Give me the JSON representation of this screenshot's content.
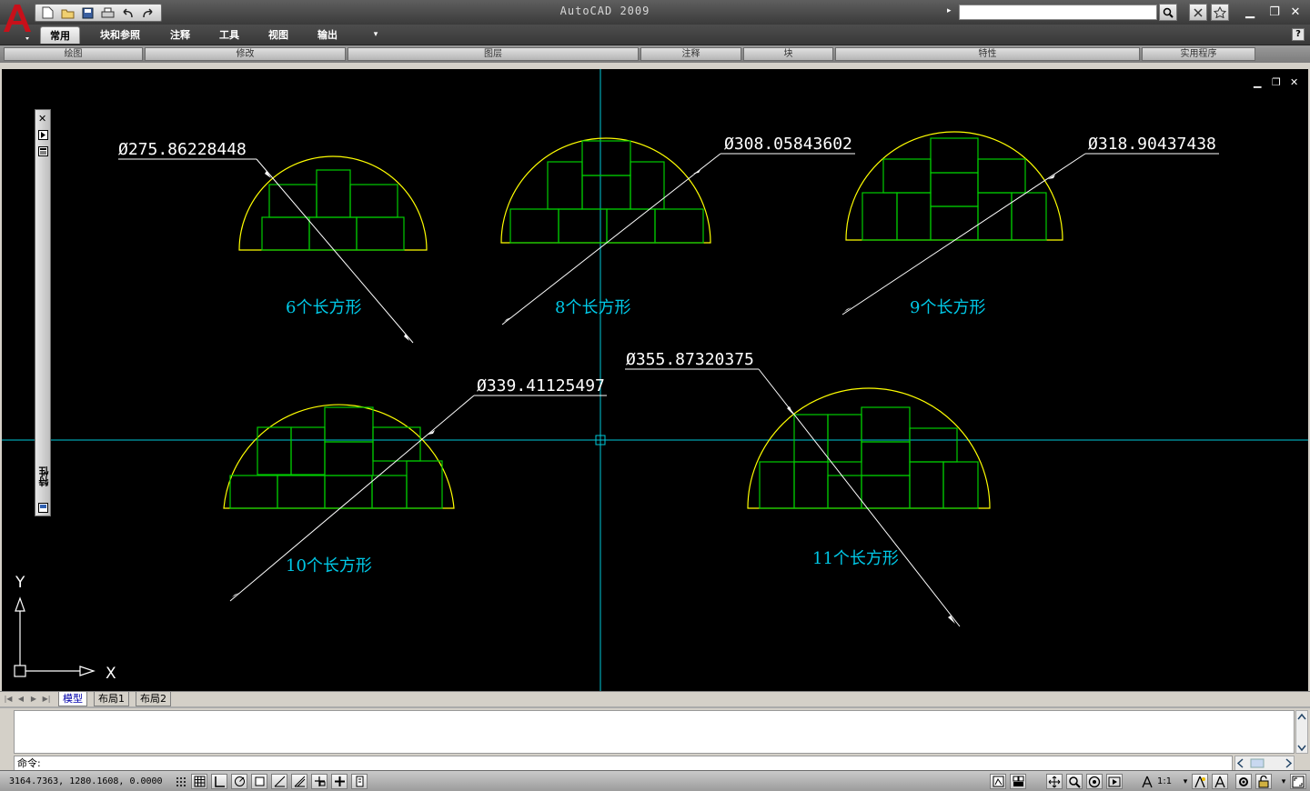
{
  "window": {
    "title": "AutoCAD 2009"
  },
  "search": {
    "placeholder": ""
  },
  "ribbon": {
    "tabs": [
      {
        "label": "常用",
        "active": true
      },
      {
        "label": "块和参照"
      },
      {
        "label": "注释"
      },
      {
        "label": "工具"
      },
      {
        "label": "视图"
      },
      {
        "label": "输出"
      }
    ],
    "panels": [
      "绘图",
      "修改",
      "图层",
      "注释",
      "块",
      "特性",
      "实用程序"
    ]
  },
  "drawing": {
    "background": "#000000",
    "arc_color": "#ffff00",
    "rect_color": "#00cc00",
    "dim_color": "#ffffff",
    "label_color": "#00c8e6",
    "crosshair_color": "#00c8d8",
    "dimensions": [
      "Ø275.86228448",
      "Ø308.05843602",
      "Ø318.90437438",
      "Ø339.41125497",
      "Ø355.87320375"
    ],
    "labels": [
      "6个长方形",
      "8个长方形",
      "9个长方形",
      "10个长方形",
      "11个长方形"
    ],
    "ucs": {
      "x_label": "X",
      "y_label": "Y"
    }
  },
  "palette": {
    "title": "特性"
  },
  "layout_tabs": [
    "模型",
    "布局1",
    "布局2"
  ],
  "command": {
    "prompt": "命令:"
  },
  "status": {
    "coordinates": "3164.7363, 1280.1608, 0.0000",
    "annotation_scale": "1:1"
  }
}
